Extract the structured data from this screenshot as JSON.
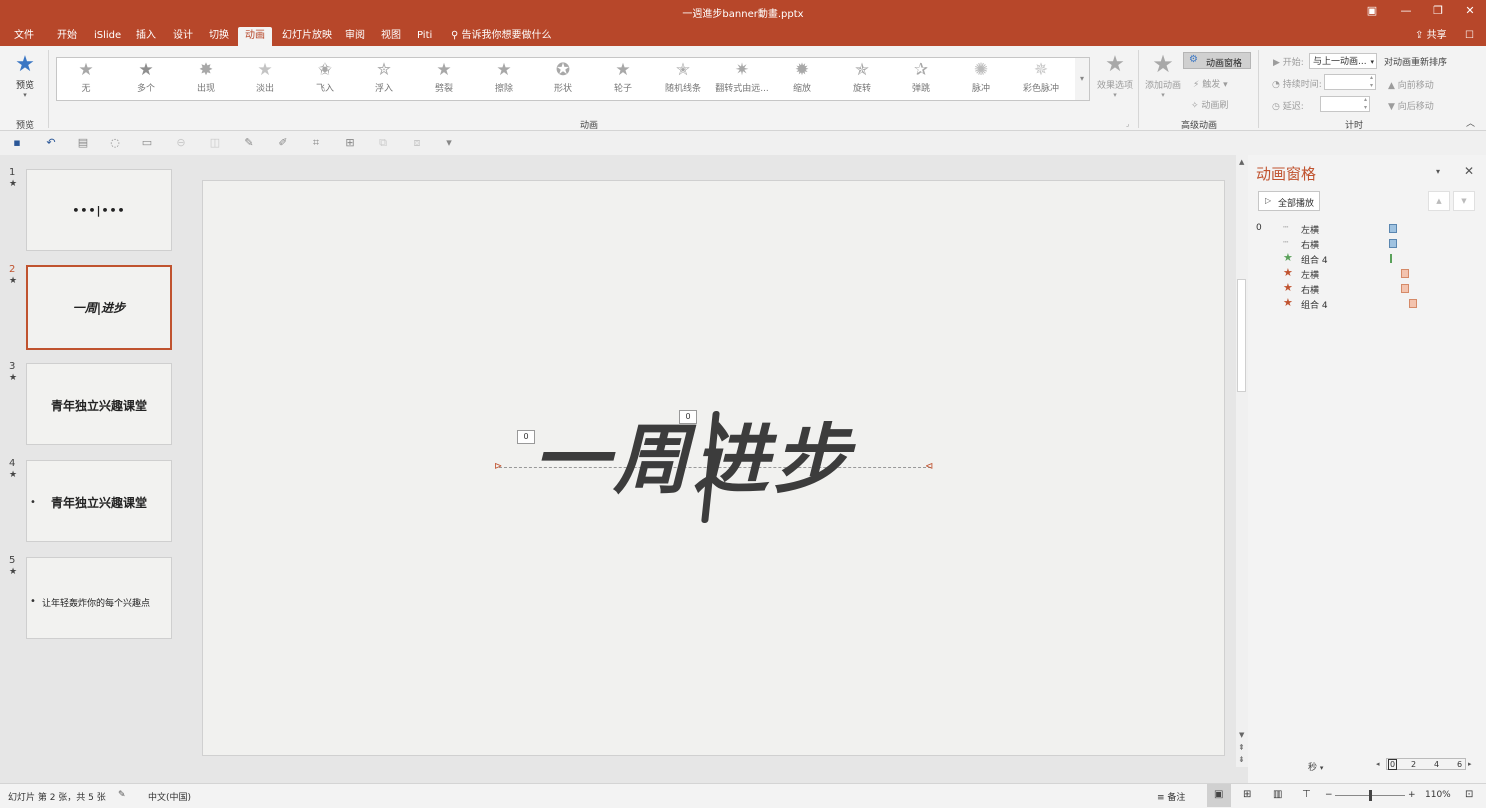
{
  "window": {
    "title": "一週進步banner動畫.pptx"
  },
  "tabs": [
    "文件",
    "开始",
    "iSlide",
    "插入",
    "设计",
    "切换",
    "动画",
    "幻灯片放映",
    "审阅",
    "视图",
    "Piti"
  ],
  "active_tab": "动画",
  "tell_me": "告诉我你想要做什么",
  "share_label": "共享",
  "ribbon": {
    "preview": {
      "label": "预览",
      "group": "预览"
    },
    "animations_group": "动画",
    "gallery": [
      "无",
      "多个",
      "出现",
      "淡出",
      "飞入",
      "浮入",
      "劈裂",
      "擦除",
      "形状",
      "轮子",
      "随机线条",
      "翻转式由远...",
      "缩放",
      "旋转",
      "弹跳",
      "脉冲",
      "彩色脉冲"
    ],
    "effect_options": "效果选项",
    "advanced": {
      "group": "高级动画",
      "add_animation": "添加动画",
      "animation_pane": "动画窗格",
      "trigger": "触发",
      "painter": "动画刷"
    },
    "timing": {
      "group": "计时",
      "start_label": "开始:",
      "start_value": "与上一动画...",
      "duration_label": "持续时间:",
      "delay_label": "延迟:",
      "reorder": "对动画重新排序",
      "move_earlier": "向前移动",
      "move_later": "向后移动"
    }
  },
  "slides": [
    {
      "num": "1",
      "mark": "★",
      "text": "•••|•••"
    },
    {
      "num": "2",
      "mark": "★",
      "text": "一周|进步"
    },
    {
      "num": "3",
      "mark": "★",
      "text": "青年独立兴趣课堂"
    },
    {
      "num": "4",
      "mark": "★",
      "text": "青年独立兴趣课堂",
      "bullet": "•"
    },
    {
      "num": "5",
      "mark": "★",
      "text": "让年轻轰炸你的每个兴趣点",
      "bullet": "•"
    }
  ],
  "canvas": {
    "main_text": "一周进步",
    "tags": [
      "0",
      "0"
    ]
  },
  "pane": {
    "title": "动画窗格",
    "play_all": "全部播放",
    "items": [
      {
        "num": "0",
        "icon": "line",
        "name": "左横",
        "color": "#9fc2e0"
      },
      {
        "num": "",
        "icon": "line",
        "name": "右横",
        "color": "#9fc2e0"
      },
      {
        "num": "",
        "icon": "star-green",
        "name": "组合 4",
        "color": "#5aa15a"
      },
      {
        "num": "",
        "icon": "star-red",
        "name": "左横",
        "color": "#f3c3ae"
      },
      {
        "num": "",
        "icon": "star-red",
        "name": "右横",
        "color": "#f3c3ae"
      },
      {
        "num": "",
        "icon": "star-red",
        "name": "组合 4",
        "color": "#f3c3ae"
      }
    ],
    "seconds_label": "秒",
    "timeline": [
      "0",
      "2",
      "4",
      "6"
    ]
  },
  "status": {
    "slide_info": "幻灯片 第 2 张，共 5 张",
    "language": "中文(中国)",
    "notes": "备注",
    "zoom": "110%"
  },
  "colors": {
    "accent": "#b7472a"
  }
}
